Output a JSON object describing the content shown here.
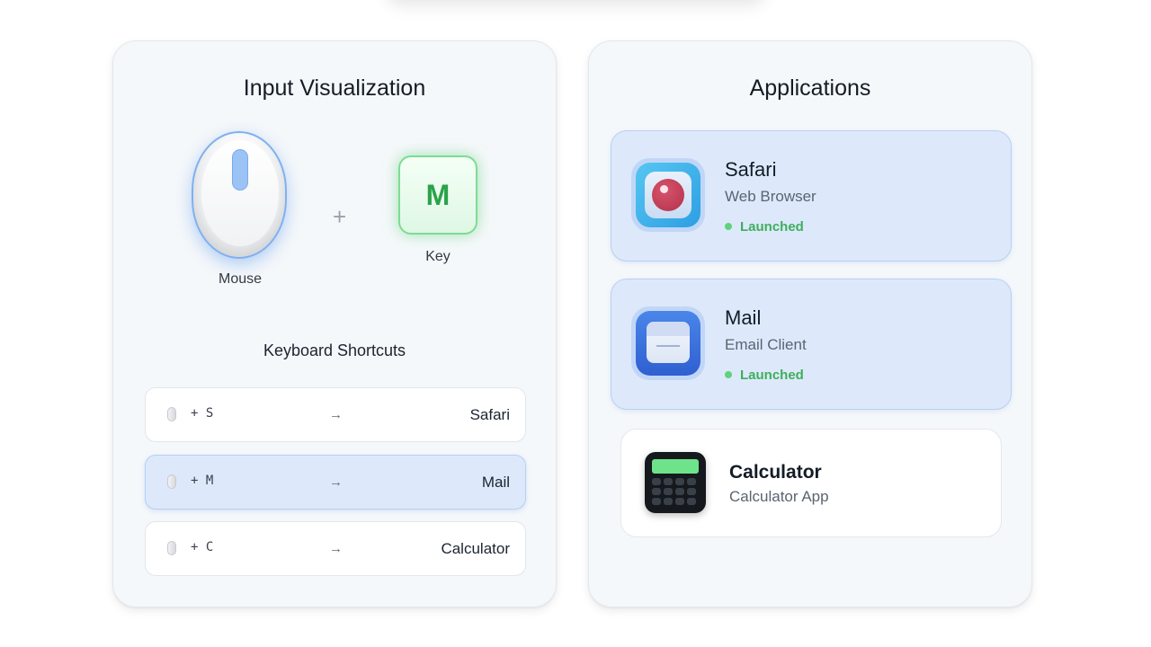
{
  "input_panel": {
    "title": "Input Visualization",
    "mouse_label": "Mouse",
    "plus": "+",
    "key": {
      "letter": "M",
      "label": "Key"
    },
    "shortcuts_title": "Keyboard Shortcuts",
    "shortcuts": [
      {
        "combo": "+ S",
        "arrow": "→",
        "target": "Safari",
        "active": false
      },
      {
        "combo": "+ M",
        "arrow": "→",
        "target": "Mail",
        "active": true
      },
      {
        "combo": "+ C",
        "arrow": "→",
        "target": "Calculator",
        "active": false
      }
    ]
  },
  "apps_panel": {
    "title": "Applications",
    "apps": [
      {
        "name": "Safari",
        "subtitle": "Web Browser",
        "status": "Launched",
        "icon": "safari-icon",
        "launched": true
      },
      {
        "name": "Mail",
        "subtitle": "Email Client",
        "status": "Launched",
        "icon": "mail-icon",
        "launched": true
      },
      {
        "name": "Calculator",
        "subtitle": "Calculator App",
        "icon": "calculator-icon",
        "launched": false
      }
    ]
  },
  "colors": {
    "active_card": "#dde9fb",
    "launched_status": "#3fae5c",
    "key_glow": "#7ddc93",
    "mouse_highlight": "#7fb0f0"
  }
}
